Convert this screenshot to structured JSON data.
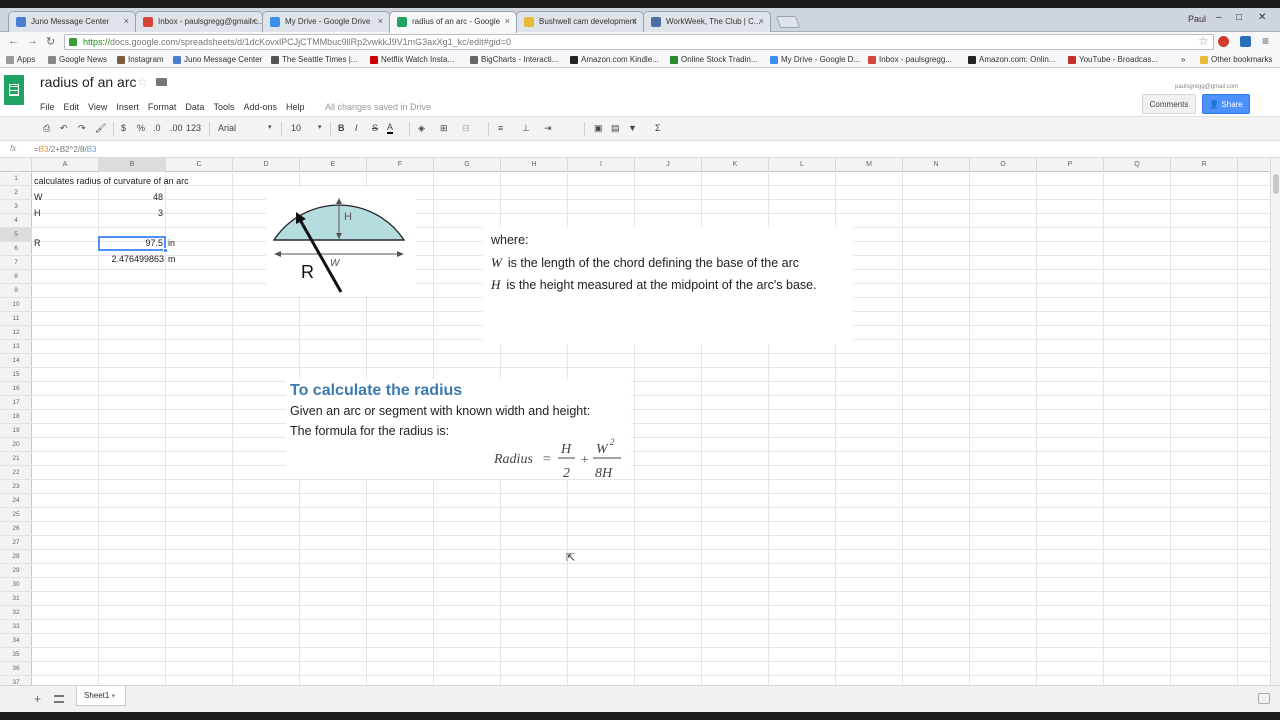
{
  "browser": {
    "tabs": [
      {
        "title": "Juno Message Center",
        "color": "#4a7fd4"
      },
      {
        "title": "Inbox - paulsgregg@gmail.c...",
        "color": "#d44638"
      },
      {
        "title": "My Drive - Google Drive",
        "color": "#3b8eea"
      },
      {
        "title": "radius of an arc - Google",
        "color": "#1ea362"
      },
      {
        "title": "Bushwell cam development",
        "color": "#e8b93a"
      },
      {
        "title": "WorkWeek, The Club | C...",
        "color": "#4a6fa5"
      }
    ],
    "user": "Paul",
    "url_https": "https://",
    "url_rest": "docs.google.com/spreadsheets/d/1dcKovxlPCJjCTMMbuc9llRp2vwkkJ9V1mG3axXg1_kc/edit#gid=0",
    "bookmarks": [
      "Apps",
      "Google News",
      "Instagram",
      "Juno Message Center",
      "The Seattle Times |...",
      "Netflix Watch Insta...",
      "BigCharts - Interacti...",
      "Amazon.com Kindle...",
      "Online Stock Tradin...",
      "My Drive - Google D...",
      "Inbox - paulsgregg...",
      "Amazon.com: Onlin...",
      "YouTube - Broadcas..."
    ],
    "other_bookmarks": "Other bookmarks"
  },
  "doc": {
    "title": "radius of an arc",
    "menus": [
      "File",
      "Edit",
      "View",
      "Insert",
      "Format",
      "Data",
      "Tools",
      "Add-ons",
      "Help"
    ],
    "saved_status": "All changes saved in Drive",
    "user_email": "paulsgregg@gmail.com",
    "comments_label": "Comments",
    "share_label": "Share"
  },
  "toolbar": {
    "format_pct": "%",
    "format_dec1": ".0",
    "format_dec2": ".00",
    "format_more": "123",
    "font": "Arial",
    "size": "10",
    "bold": "B",
    "italic": "I",
    "strike": "S",
    "textcolor": "A",
    "sigma": "Σ"
  },
  "formula_bar": {
    "fx": "fx",
    "prefix": "=",
    "ref1": "B3",
    "mid": "/2+B2^2/8/",
    "ref2": "B3"
  },
  "columns": [
    "A",
    "B",
    "C",
    "D",
    "E",
    "F",
    "G",
    "H",
    "I",
    "J",
    "K",
    "L",
    "M",
    "N",
    "O",
    "P",
    "Q",
    "R"
  ],
  "cells": {
    "a1": "calculates radius of curvature of an arc",
    "a2": "W",
    "b2": "48",
    "a3": "H",
    "b3": "3",
    "a5": "R",
    "b5": "97.5",
    "c5": "in",
    "b6": "2.476499863",
    "c6": "m"
  },
  "diagram": {
    "h_label": "H",
    "w_label": "W",
    "r_label": "R",
    "fill": "#b5dde0"
  },
  "where_text": {
    "heading": "where:",
    "w_var": "W",
    "w_desc": "is the length of the chord defining the base of the arc",
    "h_var": "H",
    "h_desc": "is the height measured at the midpoint of the arc's base."
  },
  "howto": {
    "title": "To calculate the radius",
    "body1": "Given an arc or segment with known width and height:",
    "body2": "The formula for the radius is:"
  },
  "formula": {
    "lhs": "Radius",
    "eq": "=",
    "num1": "H",
    "den1": "2",
    "plus": "+",
    "num2": "W",
    "sup": "2",
    "den2": "8H"
  },
  "sheet": {
    "tab_label": "Sheet1",
    "add": "+"
  }
}
